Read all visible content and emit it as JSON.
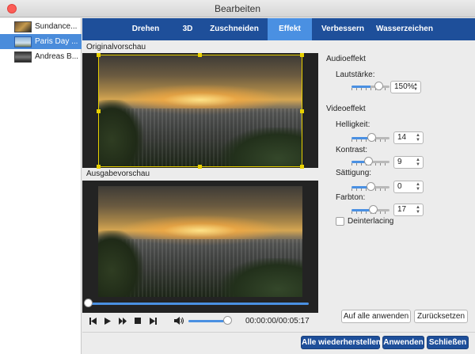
{
  "window": {
    "title": "Bearbeiten"
  },
  "files": [
    {
      "label": "Sundance..."
    },
    {
      "label": "Paris Day ..."
    },
    {
      "label": "Andreas B..."
    }
  ],
  "tabs": [
    {
      "label": "Drehen"
    },
    {
      "label": "3D"
    },
    {
      "label": "Zuschneiden"
    },
    {
      "label": "Effekt"
    },
    {
      "label": "Verbessern"
    },
    {
      "label": "Wasserzeichen"
    }
  ],
  "active_tab": "Effekt",
  "preview": {
    "original_label": "Originalvorschau",
    "output_label": "Ausgabevorschau",
    "progress": 0.0,
    "volume": 0.9,
    "timecode": "00:00:00/00:05:17"
  },
  "audio": {
    "title": "Audioeffekt",
    "volume_label": "Lautstärke:",
    "volume_value": "150%"
  },
  "video": {
    "title": "Videoeffekt",
    "brightness_label": "Helligkeit:",
    "brightness_value": "14",
    "contrast_label": "Kontrast:",
    "contrast_value": "9",
    "saturation_label": "Sättigung:",
    "saturation_value": "0",
    "hue_label": "Farbton:",
    "hue_value": "17",
    "deinterlacing_label": "Deinterlacing",
    "deinterlacing_checked": false
  },
  "buttons": {
    "apply_all": "Auf alle anwenden",
    "reset": "Zurücksetzen",
    "restore_all": "Alle wiederherstellen",
    "apply": "Anwenden",
    "close": "Schließen"
  },
  "colors": {
    "tabbar": "#1e4f9a",
    "active_tab": "#4a90e2",
    "selection": "#4a8cdb",
    "crop_frame": "#e8d000"
  }
}
